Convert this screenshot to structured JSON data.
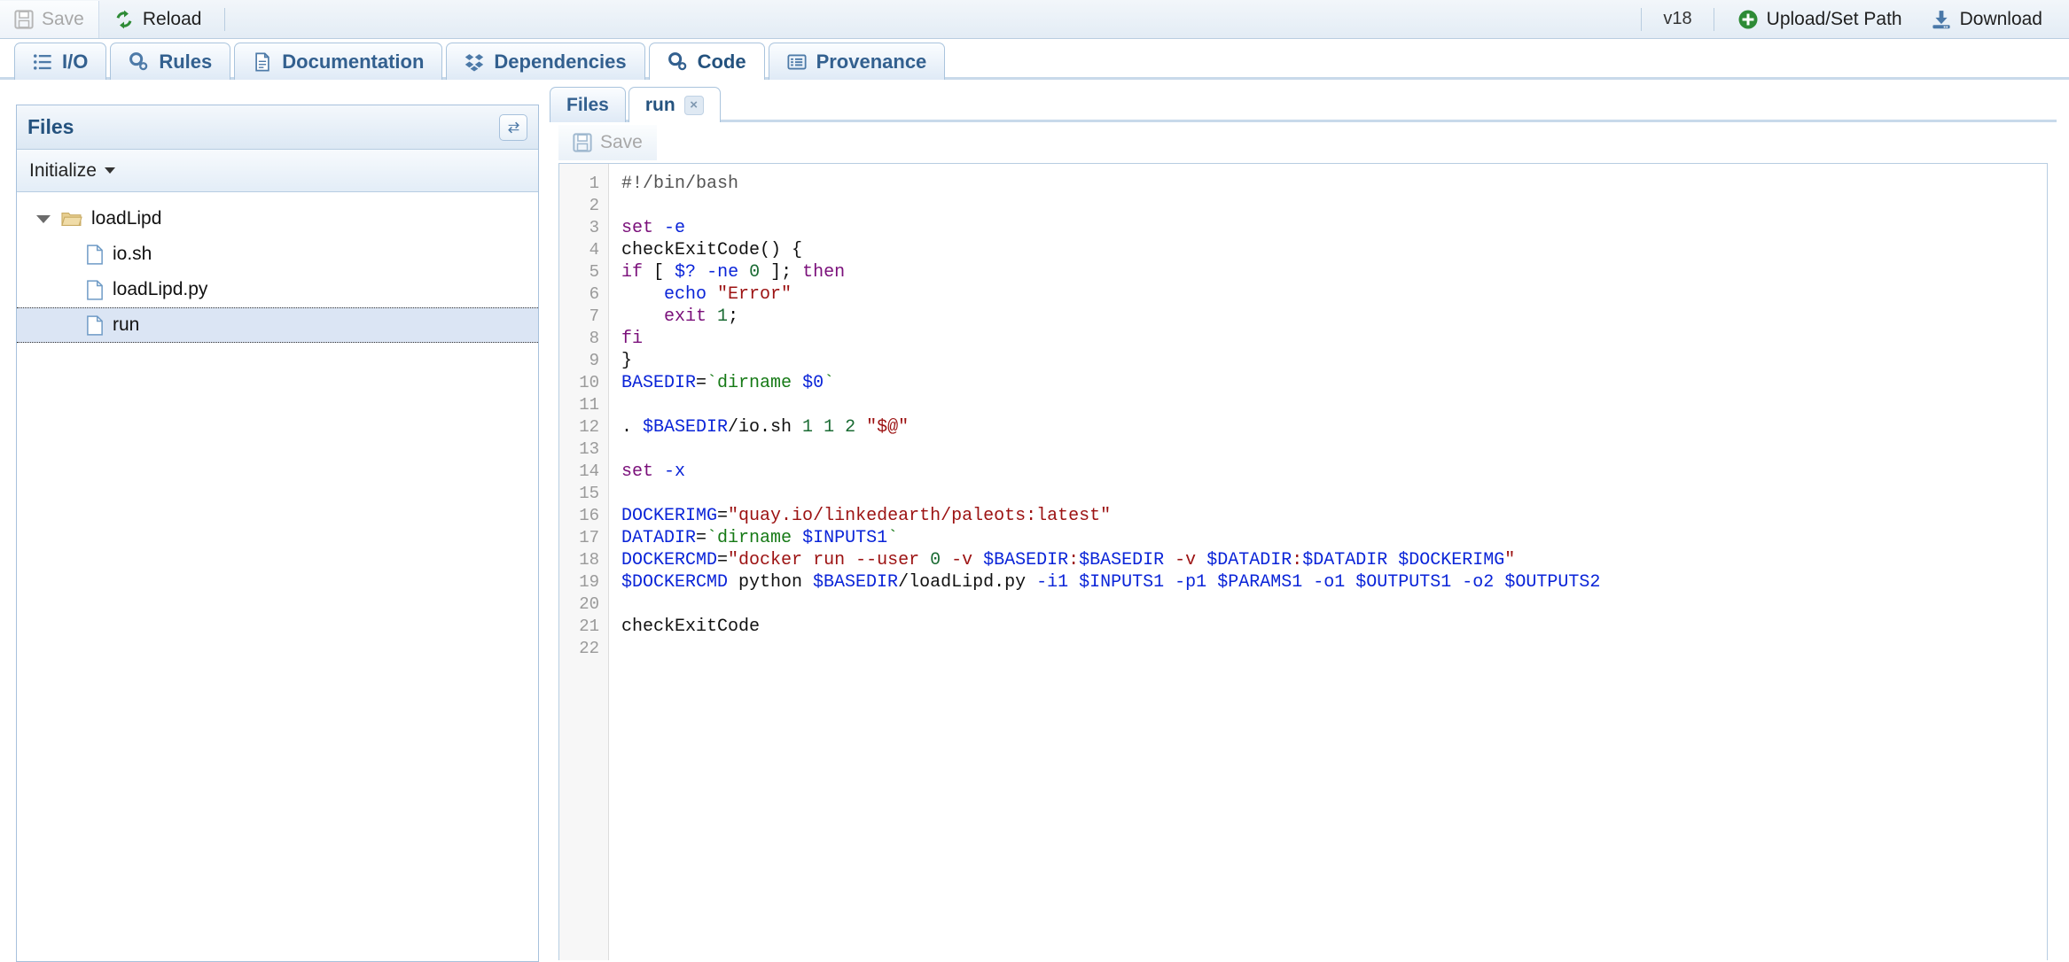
{
  "toolbar": {
    "save_label": "Save",
    "save_icon": "floppy-disk-icon",
    "reload_label": "Reload",
    "reload_icon": "refresh-icon",
    "version": "v18",
    "upload_label": "Upload/Set Path",
    "upload_icon": "plus-circle-icon",
    "download_label": "Download",
    "download_icon": "download-icon"
  },
  "main_tabs": [
    {
      "label": "I/O",
      "icon": "list-icon",
      "active": false
    },
    {
      "label": "Rules",
      "icon": "gears-icon",
      "active": false
    },
    {
      "label": "Documentation",
      "icon": "document-icon",
      "active": false
    },
    {
      "label": "Dependencies",
      "icon": "dropbox-icon",
      "active": false
    },
    {
      "label": "Code",
      "icon": "gears-icon",
      "active": true
    },
    {
      "label": "Provenance",
      "icon": "listbox-icon",
      "active": false
    }
  ],
  "files_panel": {
    "title": "Files",
    "refresh_icon": "refresh-arrows-icon",
    "menu_label": "Initialize",
    "tree": [
      {
        "label": "loadLipd",
        "type": "folder",
        "depth": 0,
        "expanded": true,
        "selected": false,
        "icon": "folder-open-icon"
      },
      {
        "label": "io.sh",
        "type": "file",
        "depth": 1,
        "expanded": false,
        "selected": false,
        "icon": "file-icon"
      },
      {
        "label": "loadLipd.py",
        "type": "file",
        "depth": 1,
        "expanded": false,
        "selected": false,
        "icon": "file-icon"
      },
      {
        "label": "run",
        "type": "file",
        "depth": 1,
        "expanded": false,
        "selected": true,
        "icon": "file-icon"
      }
    ]
  },
  "editor": {
    "tabs": [
      {
        "label": "Files",
        "active": false,
        "closable": false
      },
      {
        "label": "run",
        "active": true,
        "closable": true,
        "close_label": "×"
      }
    ],
    "save_label": "Save",
    "save_icon": "floppy-disk-icon",
    "line_numbers": [
      "1",
      "2",
      "3",
      "4",
      "5",
      "6",
      "7",
      "8",
      "9",
      "10",
      "11",
      "12",
      "13",
      "14",
      "15",
      "16",
      "17",
      "18",
      "19",
      "20",
      "21",
      "22"
    ],
    "code_lines": [
      [
        {
          "t": "#!/bin/bash",
          "c": "cmt"
        }
      ],
      [],
      [
        {
          "t": "set",
          "c": "kw"
        },
        {
          "t": " ",
          "c": "plain"
        },
        {
          "t": "-e",
          "c": "var"
        }
      ],
      [
        {
          "t": "checkExitCode() {",
          "c": "plain"
        }
      ],
      [
        {
          "t": "if",
          "c": "kw"
        },
        {
          "t": " [ ",
          "c": "plain"
        },
        {
          "t": "$?",
          "c": "var"
        },
        {
          "t": " ",
          "c": "plain"
        },
        {
          "t": "-ne",
          "c": "var"
        },
        {
          "t": " ",
          "c": "plain"
        },
        {
          "t": "0",
          "c": "num"
        },
        {
          "t": " ]; ",
          "c": "plain"
        },
        {
          "t": "then",
          "c": "kw"
        }
      ],
      [
        {
          "t": "    ",
          "c": "plain"
        },
        {
          "t": "echo",
          "c": "var"
        },
        {
          "t": " ",
          "c": "plain"
        },
        {
          "t": "\"Error\"",
          "c": "str"
        }
      ],
      [
        {
          "t": "    ",
          "c": "plain"
        },
        {
          "t": "exit",
          "c": "kw"
        },
        {
          "t": " ",
          "c": "plain"
        },
        {
          "t": "1",
          "c": "num"
        },
        {
          "t": ";",
          "c": "plain"
        }
      ],
      [
        {
          "t": "fi",
          "c": "kw"
        }
      ],
      [
        {
          "t": "}",
          "c": "plain"
        }
      ],
      [
        {
          "t": "BASEDIR",
          "c": "var"
        },
        {
          "t": "=",
          "c": "plain"
        },
        {
          "t": "`dirname ",
          "c": "cmd"
        },
        {
          "t": "$0",
          "c": "var"
        },
        {
          "t": "`",
          "c": "cmd"
        }
      ],
      [],
      [
        {
          "t": ". ",
          "c": "plain"
        },
        {
          "t": "$BASEDIR",
          "c": "var"
        },
        {
          "t": "/io.sh ",
          "c": "plain"
        },
        {
          "t": "1",
          "c": "num"
        },
        {
          "t": " ",
          "c": "plain"
        },
        {
          "t": "1",
          "c": "num"
        },
        {
          "t": " ",
          "c": "plain"
        },
        {
          "t": "2",
          "c": "num"
        },
        {
          "t": " ",
          "c": "plain"
        },
        {
          "t": "\"$@\"",
          "c": "str"
        }
      ],
      [],
      [
        {
          "t": "set",
          "c": "kw"
        },
        {
          "t": " ",
          "c": "plain"
        },
        {
          "t": "-x",
          "c": "var"
        }
      ],
      [],
      [
        {
          "t": "DOCKERIMG",
          "c": "var"
        },
        {
          "t": "=",
          "c": "plain"
        },
        {
          "t": "\"quay.io/linkedearth/paleots:latest\"",
          "c": "str"
        }
      ],
      [
        {
          "t": "DATADIR",
          "c": "var"
        },
        {
          "t": "=",
          "c": "plain"
        },
        {
          "t": "`dirname ",
          "c": "cmd"
        },
        {
          "t": "$INPUTS1",
          "c": "var"
        },
        {
          "t": "`",
          "c": "cmd"
        }
      ],
      [
        {
          "t": "DOCKERCMD",
          "c": "var"
        },
        {
          "t": "=",
          "c": "plain"
        },
        {
          "t": "\"docker run --user ",
          "c": "str"
        },
        {
          "t": "0",
          "c": "num"
        },
        {
          "t": " -v ",
          "c": "str"
        },
        {
          "t": "$BASEDIR",
          "c": "var"
        },
        {
          "t": ":",
          "c": "str"
        },
        {
          "t": "$BASEDIR",
          "c": "var"
        },
        {
          "t": " -v ",
          "c": "str"
        },
        {
          "t": "$DATADIR",
          "c": "var"
        },
        {
          "t": ":",
          "c": "str"
        },
        {
          "t": "$DATADIR",
          "c": "var"
        },
        {
          "t": " ",
          "c": "str"
        },
        {
          "t": "$DOCKERIMG",
          "c": "var"
        },
        {
          "t": "\"",
          "c": "str"
        }
      ],
      [
        {
          "t": "$DOCKERCMD",
          "c": "var"
        },
        {
          "t": " python ",
          "c": "plain"
        },
        {
          "t": "$BASEDIR",
          "c": "var"
        },
        {
          "t": "/loadLipd.py ",
          "c": "plain"
        },
        {
          "t": "-i1",
          "c": "var"
        },
        {
          "t": " ",
          "c": "plain"
        },
        {
          "t": "$INPUTS1",
          "c": "var"
        },
        {
          "t": " ",
          "c": "plain"
        },
        {
          "t": "-p1",
          "c": "var"
        },
        {
          "t": " ",
          "c": "plain"
        },
        {
          "t": "$PARAMS1",
          "c": "var"
        },
        {
          "t": " ",
          "c": "plain"
        },
        {
          "t": "-o1",
          "c": "var"
        },
        {
          "t": " ",
          "c": "plain"
        },
        {
          "t": "$OUTPUTS1",
          "c": "var"
        },
        {
          "t": " ",
          "c": "plain"
        },
        {
          "t": "-o2",
          "c": "var"
        },
        {
          "t": " ",
          "c": "plain"
        },
        {
          "t": "$OUTPUTS2",
          "c": "var"
        }
      ],
      [],
      [
        {
          "t": "checkExitCode",
          "c": "plain"
        }
      ],
      []
    ]
  },
  "colors": {
    "accent": "#24527e",
    "tab_border": "#aac4dd",
    "keyword": "#7a0f7a",
    "variable": "#0a24d8",
    "number": "#1a6b33",
    "string": "#9c1212",
    "command": "#167a16"
  }
}
